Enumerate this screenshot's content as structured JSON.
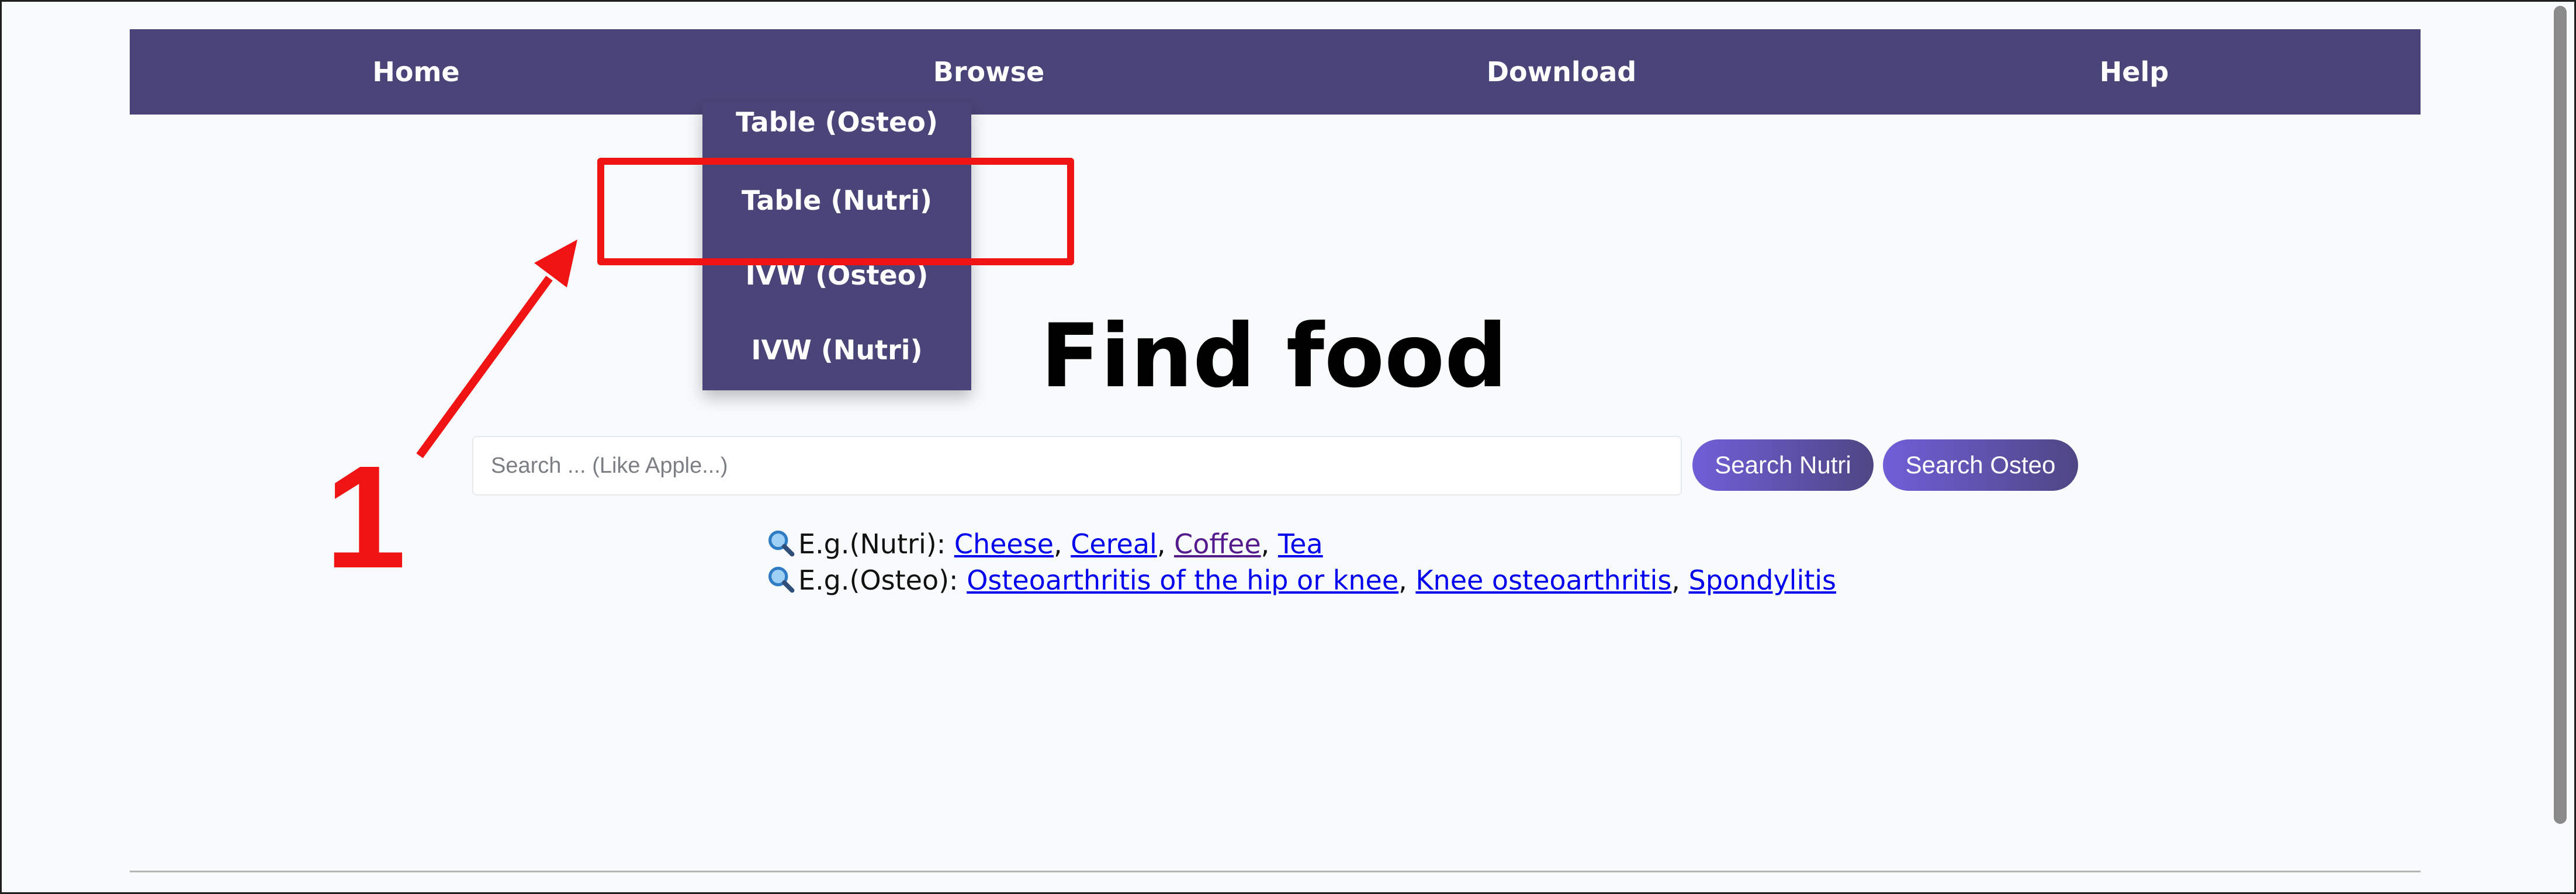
{
  "nav": {
    "items": [
      {
        "label": "Home"
      },
      {
        "label": "Browse"
      },
      {
        "label": "Download"
      },
      {
        "label": "Help"
      }
    ]
  },
  "browse_menu": {
    "items": [
      {
        "label": "Table (Osteo)"
      },
      {
        "label": "Table (Nutri)"
      },
      {
        "label": "IVW (Osteo)"
      },
      {
        "label": "IVW (Nutri)"
      }
    ]
  },
  "annotation": {
    "step": "1",
    "highlight_target": "Table (Nutri)",
    "color": "#f01414"
  },
  "main": {
    "title": "Find food",
    "search_placeholder": "Search ... (Like Apple...)",
    "search_value": "",
    "btn_nutri": "Search Nutri",
    "btn_osteo": "Search Osteo"
  },
  "examples": {
    "nutri": {
      "prefix": "E.g.(Nutri): ",
      "links": [
        "Cheese",
        "Cereal",
        "Coffee",
        "Tea"
      ],
      "visited": [
        "Coffee"
      ]
    },
    "osteo": {
      "prefix": "E.g.(Osteo): ",
      "links": [
        "Osteoarthritis of the hip or knee",
        "Knee osteoarthritis",
        "Spondylitis"
      ]
    },
    "icon": "magnifier-icon"
  },
  "colors": {
    "nav_bg": "#4a4578",
    "page_bg": "#f7fbfc",
    "button_gradient_start": "#6f5fd8",
    "button_gradient_end": "#4f4684",
    "link": "#0000ee",
    "link_visited": "#551a8b"
  }
}
